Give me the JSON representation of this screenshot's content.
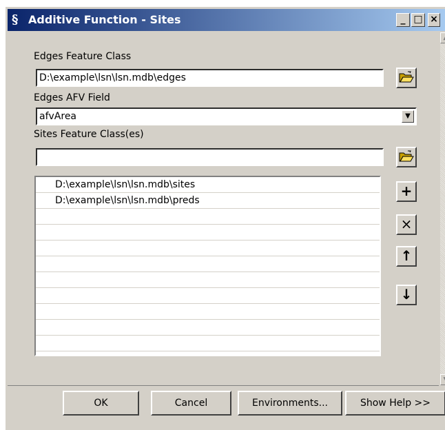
{
  "window": {
    "title": "Additive Function - Sites",
    "controls": [
      "_",
      "□",
      "×"
    ]
  },
  "form": {
    "edges_label": "Edges Feature Class",
    "edges_value": "D:\\example\\lsn\\lsn.mdb\\edges",
    "afv_label": "Edges AFV Field",
    "afv_value": "afvArea",
    "sites_label": "Sites Feature Class(es)",
    "sites_value": ""
  },
  "list": {
    "items": [
      "D:\\example\\lsn\\lsn.mdb\\sites",
      "D:\\example\\lsn\\lsn.mdb\\preds"
    ]
  },
  "side_buttons": {
    "add": "+",
    "remove": "×",
    "up": "↑",
    "down": "↓"
  },
  "footer": {
    "ok": "OK",
    "cancel": "Cancel",
    "environments": "Environments...",
    "help": "Show Help >>"
  },
  "icons": {
    "title": "python-script-icon",
    "browse": "open-folder-icon",
    "combo": "chevron-down-icon"
  }
}
